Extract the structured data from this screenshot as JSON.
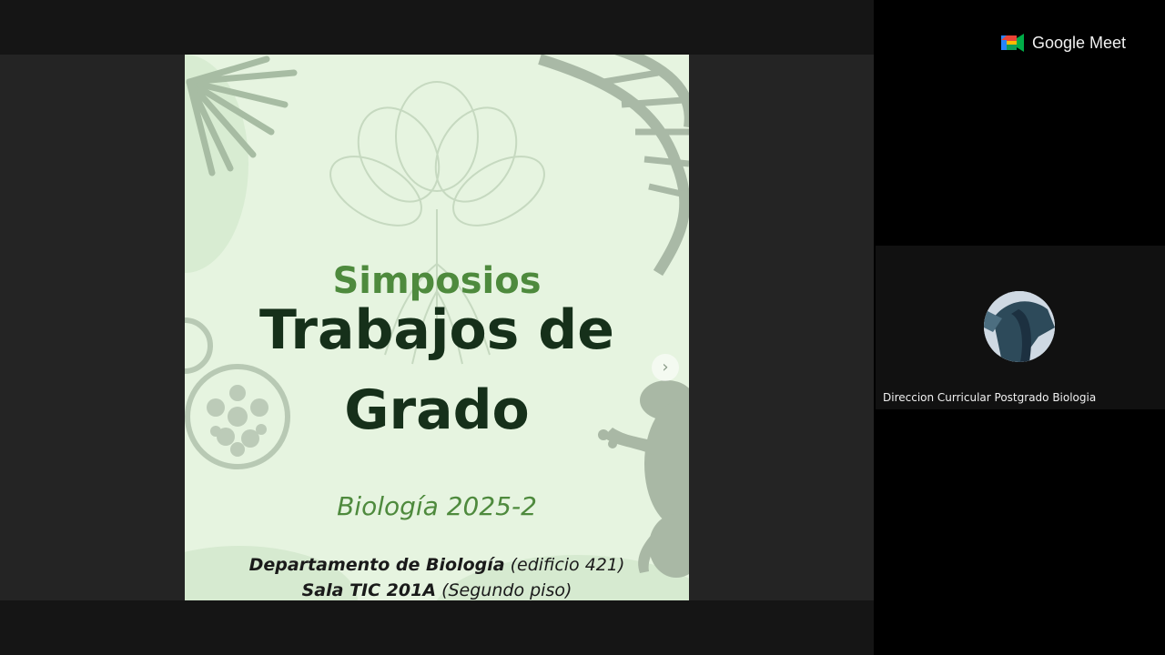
{
  "app": {
    "brand_name": "Google Meet",
    "logo_icon": "google-meet-logo-icon"
  },
  "slide": {
    "kicker": "Simposios",
    "title_line1": "Trabajos de",
    "title_line2": "Grado",
    "subtitle": "Biología 2025-2",
    "dept_bold": "Departamento de Biología",
    "dept_rest": " (edificio 421)",
    "room_bold": "Sala TIC 201A",
    "room_rest": " (Segundo piso)",
    "next_icon": "chevron-right-icon"
  },
  "participant": {
    "name": "Direccion Curricular Postgrado Biologia"
  },
  "colors": {
    "slide_bg": "#e6f4e0",
    "title_dark_green": "#16301a",
    "accent_green": "#4e8a3d",
    "sidebar_bg": "#000000"
  }
}
